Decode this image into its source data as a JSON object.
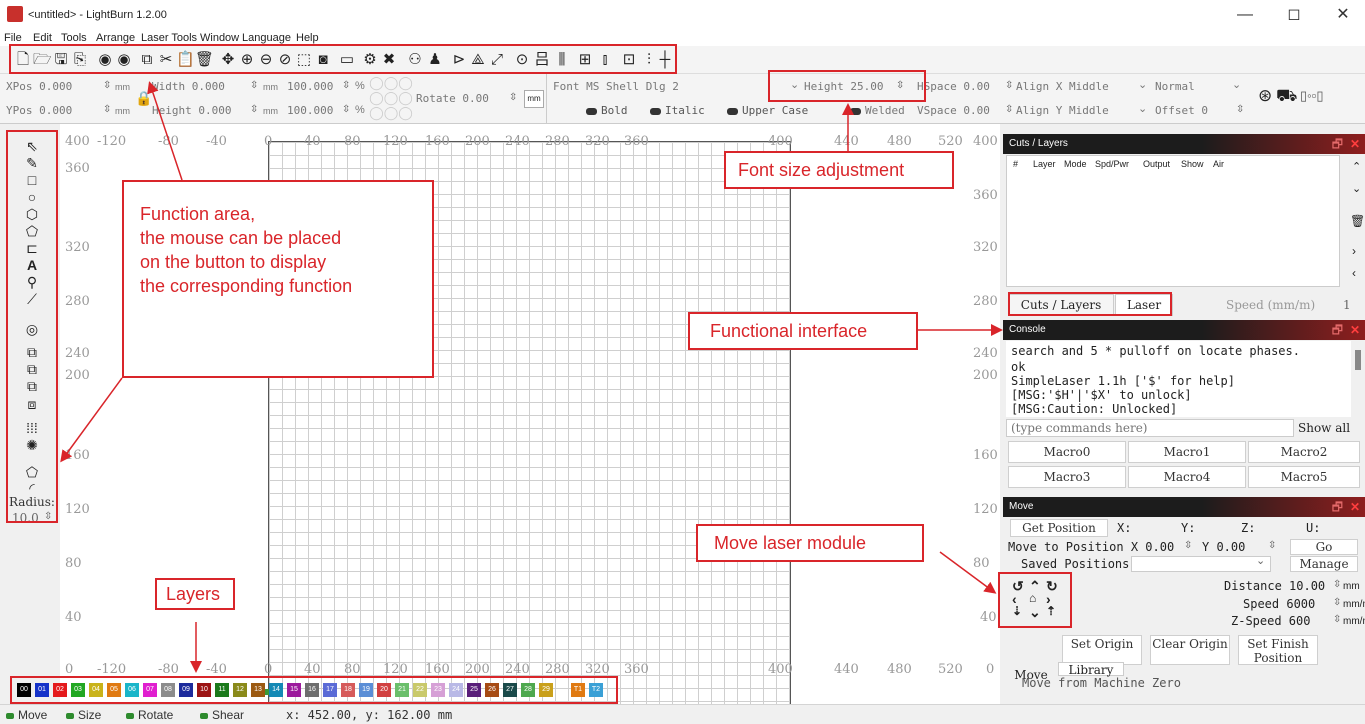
{
  "window": {
    "title": "<untitled> - LightBurn 1.2.00",
    "minimize": "—",
    "maximize": "◻",
    "close": "✕"
  },
  "menu": [
    "File",
    "Edit",
    "Tools",
    "Arrange",
    "Laser Tools",
    "Window",
    "Language",
    "Help"
  ],
  "toolbar_icons": [
    "new-file-icon",
    "open-file-icon",
    "save-icon",
    "import-icon",
    "settings-icon",
    "preview-icon",
    "copy-icon",
    "cut-icon",
    "paste-icon",
    "delete-icon",
    "move-icon",
    "zoom-in-icon",
    "zoom-out-icon",
    "zoom-fit-icon",
    "frame-icon",
    "camera-icon",
    "monitor-icon",
    "device-settings-icon",
    "tools-icon",
    "group-icon",
    "user-icon",
    "mirror-icon",
    "flip-icon",
    "rotate-icon",
    "target-icon",
    "align-icon",
    "distribute-icon",
    "array-icon",
    "spacing-icon",
    "grid-snap-icon"
  ],
  "props": {
    "xpos": "XPos 0.000",
    "ypos": "YPos 0.000",
    "unit_mm": "mm",
    "width": "Width 0.000",
    "height": "Height 0.000",
    "scale_w": "100.000",
    "scale_h": "100.000",
    "percent": "%",
    "rotate": "Rotate 0.00",
    "font": "Font MS Shell Dlg 2",
    "text_height": "Height 25.00",
    "hspace": "HSpace 0.00",
    "vspace": "VSpace 0.00",
    "align_x": "Align X Middle",
    "align_y": "Align Y Middle",
    "mode": "Normal",
    "offset": "Offset 0",
    "bold": "Bold",
    "italic": "Italic",
    "upper_case": "Upper Case",
    "welded": "Welded"
  },
  "left_tools": {
    "icons": [
      "select-icon",
      "edit-nodes-icon",
      "rectangle-icon",
      "ellipse-icon",
      "polygon-icon",
      "path-icon",
      "position-icon",
      "text-icon",
      "marker-icon",
      "measure-icon",
      "offset-icon",
      "boolean-union-icon",
      "boolean-subtract-icon",
      "boolean-intersect-icon",
      "weld-icon",
      "grid-array-icon",
      "circular-array-icon",
      "tab-icon",
      "corner-icon"
    ],
    "radius_label": "Radius:",
    "radius_value": "10.0"
  },
  "axes": {
    "x_top": [
      "-120",
      "-80",
      "-40",
      "0",
      "40",
      "80",
      "120",
      "160",
      "200",
      "240",
      "280",
      "320",
      "360",
      "400",
      "440",
      "480",
      "520"
    ],
    "x_bottom": [
      "0",
      "-120",
      "-80",
      "-40",
      "0",
      "40",
      "80",
      "120",
      "160",
      "200",
      "240",
      "280",
      "320",
      "360",
      "400",
      "440",
      "480",
      "520"
    ],
    "y_left": [
      "400",
      "360",
      "320",
      "280",
      "240",
      "200",
      "160",
      "120",
      "80",
      "40"
    ],
    "y_right": [
      "400",
      "360",
      "320",
      "280",
      "240",
      "200",
      "160",
      "120",
      "80",
      "40",
      "0"
    ]
  },
  "cuts_panel": {
    "title": "Cuts / Layers",
    "columns": [
      "#",
      "Layer",
      "Mode",
      "Spd/Pwr",
      "Output",
      "Show",
      "Air"
    ],
    "tabs": [
      "Cuts / Layers",
      "Laser"
    ],
    "speed_label": "Speed (mm/m)",
    "speed_value": "1"
  },
  "console": {
    "title": "Console",
    "lines": [
      "search and 5 * pulloff on locate phases.",
      "ok",
      "SimpleLaser 1.1h ['$' for help]",
      "[MSG:'$H'|'$X' to unlock]",
      "[MSG:Caution: Unlocked]"
    ],
    "placeholder": "(type commands here)",
    "show_all": "Show all",
    "macros": [
      "Macro0",
      "Macro1",
      "Macro2",
      "Macro3",
      "Macro4",
      "Macro5"
    ]
  },
  "move_panel": {
    "title": "Move",
    "get_position": "Get Position",
    "x_label": "X:",
    "y_label": "Y:",
    "z_label": "Z:",
    "u_label": "U:",
    "move_to": "Move to Position X 0.00",
    "move_to_y": "Y 0.00",
    "go": "Go",
    "saved_positions": "Saved Positions:",
    "manage": "Manage",
    "distance": "Distance 10.00",
    "speed": "Speed 6000",
    "zspeed": "Z-Speed 600",
    "unit_mm": "mm",
    "unit_mmm": "mm/m",
    "set_origin": "Set Origin",
    "clear_origin": "Clear Origin",
    "set_finish": "Set Finish Position",
    "tabs": [
      "Move",
      "Library"
    ],
    "move_from_zero": "Move from Machine Zero"
  },
  "palette": [
    {
      "label": "00",
      "color": "#000000"
    },
    {
      "label": "01",
      "color": "#1533c9"
    },
    {
      "label": "02",
      "color": "#e41a1c"
    },
    {
      "label": "03",
      "color": "#22a722"
    },
    {
      "label": "04",
      "color": "#c9b31b"
    },
    {
      "label": "05",
      "color": "#e07a12"
    },
    {
      "label": "06",
      "color": "#1ab5c9"
    },
    {
      "label": "07",
      "color": "#e01fcf"
    },
    {
      "label": "08",
      "color": "#8c8c8c"
    },
    {
      "label": "09",
      "color": "#1d2b9c"
    },
    {
      "label": "10",
      "color": "#9c1414"
    },
    {
      "label": "11",
      "color": "#1b7a1b"
    },
    {
      "label": "12",
      "color": "#8a8a1a"
    },
    {
      "label": "13",
      "color": "#9c5a12"
    },
    {
      "label": "14",
      "color": "#1489b5"
    },
    {
      "label": "15",
      "color": "#9c1a9c"
    },
    {
      "label": "16",
      "color": "#6e6e6e"
    },
    {
      "label": "17",
      "color": "#5b6bd6"
    },
    {
      "label": "18",
      "color": "#d65b5b"
    },
    {
      "label": "19",
      "color": "#5b8ed6"
    },
    {
      "label": "20",
      "color": "#d14040"
    },
    {
      "label": "21",
      "color": "#6bbf6b"
    },
    {
      "label": "22",
      "color": "#c9c96b"
    },
    {
      "label": "23",
      "color": "#d6a0d6"
    },
    {
      "label": "24",
      "color": "#b9b9e6"
    },
    {
      "label": "25",
      "color": "#5a1f7a"
    },
    {
      "label": "26",
      "color": "#a64b14"
    },
    {
      "label": "27",
      "color": "#1a4a4a"
    },
    {
      "label": "28",
      "color": "#4ea84e"
    },
    {
      "label": "29",
      "color": "#c9a01b"
    },
    {
      "label": "T1",
      "color": "#e07a12"
    },
    {
      "label": "T2",
      "color": "#3aa0d6"
    }
  ],
  "status": {
    "move": "Move",
    "size": "Size",
    "rotate": "Rotate",
    "shear": "Shear",
    "coords": "x: 452.00, y: 162.00 mm"
  },
  "annotations": {
    "function_area": [
      "Function area,",
      "the mouse can be placed",
      "on the button to display",
      "the corresponding function"
    ],
    "font_size": "Font size adjustment",
    "functional_interface": "Functional interface",
    "move_laser": "Move laser module",
    "layers": "Layers"
  },
  "colors": {
    "annotation": "#d9252a",
    "panel_head_from": "#1c1c1c",
    "panel_head_to": "#8e1e1e"
  }
}
